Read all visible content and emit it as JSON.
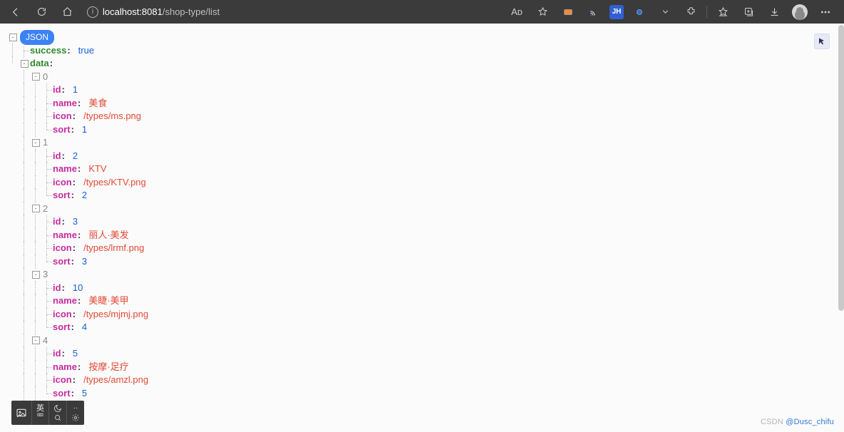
{
  "browser": {
    "url_host": "localhost",
    "url_port": ":8081",
    "url_path": "/shop-type/list",
    "aa_label": "Aᴅ",
    "jh_label": "JH"
  },
  "json": {
    "root_badge": "JSON",
    "success_key": "success",
    "success_val": "true",
    "data_key": "data",
    "items": [
      {
        "index": "0",
        "id_key": "id",
        "id_val": "1",
        "name_key": "name",
        "name_val": "美食",
        "icon_key": "icon",
        "icon_val": "/types/ms.png",
        "sort_key": "sort",
        "sort_val": "1"
      },
      {
        "index": "1",
        "id_key": "id",
        "id_val": "2",
        "name_key": "name",
        "name_val": "KTV",
        "icon_key": "icon",
        "icon_val": "/types/KTV.png",
        "sort_key": "sort",
        "sort_val": "2"
      },
      {
        "index": "2",
        "id_key": "id",
        "id_val": "3",
        "name_key": "name",
        "name_val": "丽人·美发",
        "icon_key": "icon",
        "icon_val": "/types/lrmf.png",
        "sort_key": "sort",
        "sort_val": "3"
      },
      {
        "index": "3",
        "id_key": "id",
        "id_val": "10",
        "name_key": "name",
        "name_val": "美睫·美甲",
        "icon_key": "icon",
        "icon_val": "/types/mjmj.png",
        "sort_key": "sort",
        "sort_val": "4"
      },
      {
        "index": "4",
        "id_key": "id",
        "id_val": "5",
        "name_key": "name",
        "name_val": "按摩·足疗",
        "icon_key": "icon",
        "icon_val": "/types/amzl.png",
        "sort_key": "sort",
        "sort_val": "5"
      }
    ]
  },
  "ime": {
    "lang": "英",
    "kb": "罒"
  },
  "watermark": {
    "prefix": "CSDN ",
    "author": "@Dusc_chifu"
  }
}
